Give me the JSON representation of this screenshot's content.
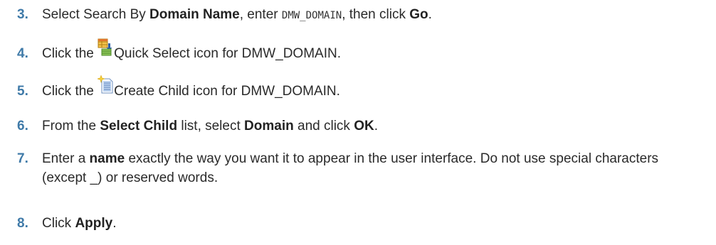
{
  "steps": [
    {
      "number": "3.",
      "parts": [
        "Select Search By ",
        "Domain Name",
        ", enter ",
        "DMW_DOMAIN",
        ", then click ",
        "Go",
        "."
      ]
    },
    {
      "number": "4.",
      "icon": "quick-select-icon",
      "parts": [
        "Click the ",
        "Quick Select icon for DMW_DOMAIN."
      ]
    },
    {
      "number": "5.",
      "icon": "create-child-icon",
      "parts": [
        "Click the ",
        "Create Child icon for DMW_DOMAIN."
      ]
    },
    {
      "number": "6.",
      "parts": [
        "From the ",
        "Select Child",
        " list, select ",
        "Domain",
        " and click ",
        "OK",
        "."
      ]
    },
    {
      "number": "7.",
      "parts": [
        "Enter a ",
        "name",
        " exactly the way you want it to appear in the user interface. Do not use special characters (except _) or reserved words."
      ]
    },
    {
      "number": "8.",
      "parts": [
        "Click ",
        "Apply",
        "."
      ]
    }
  ],
  "colors": {
    "step_number": "#3f7aa8",
    "text": "#2a2a2a"
  }
}
